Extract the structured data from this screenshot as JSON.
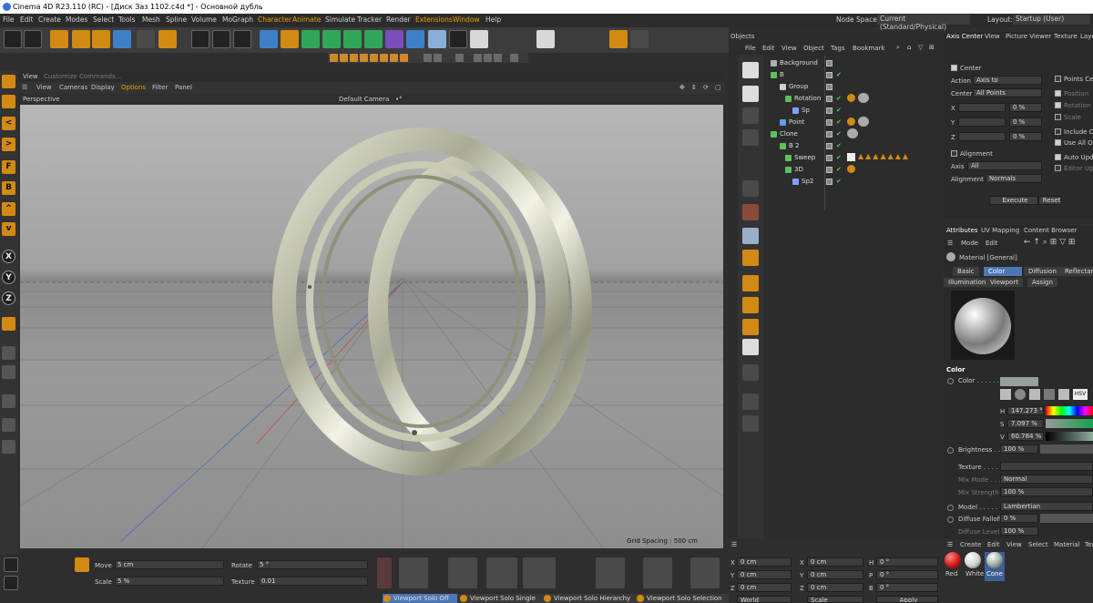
{
  "title": "Cinema 4D R23.110 (RC) - [Диск Заз 1102.c4d *] - Основной дубль",
  "menu": [
    "File",
    "Edit",
    "Create",
    "Modes",
    "Select",
    "Tools",
    "Mesh",
    "Spline",
    "Volume",
    "MoGraph",
    "Character",
    "Animate",
    "Simulate",
    "Tracker",
    "Render",
    "Extensions",
    "Window",
    "Help"
  ],
  "nodespace": {
    "label": "Node Space:",
    "value": "Current (Standard/Physical)"
  },
  "layout": {
    "label": "Layout:",
    "value": "Startup (User)"
  },
  "left_tools": [
    "F",
    "B",
    "X",
    "Y",
    "Z"
  ],
  "viewport": {
    "tab_view": "View",
    "tab_custom": "Customize Commands...",
    "menu": [
      "View",
      "Cameras",
      "Display",
      "Options",
      "Filter",
      "Panel"
    ],
    "name": "Perspective",
    "camera": "Default Camera",
    "camera_suffix": "•°",
    "grid_spacing": "Grid Spacing : 500 cm"
  },
  "coords": {
    "move_label": "Move",
    "move_value": "5 cm",
    "scale_label": "Scale",
    "scale_value": "5 %",
    "rotate_label": "Rotate",
    "rotate_value": "5 °",
    "texture_label": "Texture",
    "texture_value": "0.01"
  },
  "solo": [
    "Viewport Solo Off",
    "Viewport Solo Single",
    "Viewport Solo Hierarchy",
    "Viewport Solo Selection"
  ],
  "objects": {
    "tab": "Objects",
    "menu": [
      "File",
      "Edit",
      "View",
      "Object",
      "Tags",
      "Bookmark"
    ],
    "items": [
      {
        "name": "Background"
      },
      {
        "name": "B"
      },
      {
        "name": "Group"
      },
      {
        "name": "Rotation"
      },
      {
        "name": "Sp"
      },
      {
        "name": "Point"
      },
      {
        "name": "Clone"
      },
      {
        "name": "B 2"
      },
      {
        "name": "Sweep"
      },
      {
        "name": "3D"
      },
      {
        "name": "Sp2"
      }
    ]
  },
  "axis_panel": {
    "tabs": [
      "Axis Center",
      "View",
      "Picture Viewer",
      "Texture",
      "Layer"
    ],
    "center": "Center",
    "action_label": "Action",
    "action_value": "Axis to",
    "center_label": "Center",
    "center_value": "All Points",
    "x": "X",
    "y": "Y",
    "z": "Z",
    "pct": "0 %",
    "points_center": "Points Center",
    "position": "Position",
    "rotation": "Rotation",
    "scale": "Scale",
    "include_children": "Include Children",
    "use_all_objects": "Use All Objects",
    "alignment": "Alignment",
    "axis_label": "Axis",
    "axis_value": "All",
    "alignment_label": "Alignment",
    "alignment_value": "Normals",
    "auto_update": "Auto Update",
    "editor_update": "Editor Update",
    "execute": "Execute",
    "reset": "Reset"
  },
  "attributes": {
    "tabs": [
      "Attributes",
      "UV Mapping",
      "Content Browser"
    ],
    "mode": "Mode",
    "edit": "Edit",
    "material": "Material [General]",
    "mtabs": [
      "Basic",
      "Color",
      "Diffusion",
      "Reflectance"
    ],
    "mtabs2": [
      "Illumination",
      "Viewport",
      "Assign"
    ],
    "section": "Color",
    "color_label": "Color . . . . . .",
    "h_label": "H",
    "h_value": "147.273 °",
    "s_label": "S",
    "s_value": "7.097 %",
    "v_label": "V",
    "v_value": "60.784 %",
    "brightness_label": "Brightness . .",
    "brightness_value": "100 %",
    "texture_label": "Texture . . . . .",
    "mixmode_label": "Mix Mode . . .",
    "mixmode_value": "Normal",
    "mixstrength_label": "Mix Strength",
    "mixstrength_value": "100 %",
    "model_label": "Model . . . . . .",
    "model_value": "Lambertian",
    "falloff_label": "Diffuse Falloff",
    "falloff_value": "0 %",
    "level_label": "Diffuse Level",
    "level_value": "100 %",
    "hsv_button": "HSV"
  },
  "coord_manager": {
    "rows": [
      {
        "a": "X",
        "av": "0 cm",
        "b": "X",
        "bv": "0 cm",
        "c": "H",
        "cv": "0 °"
      },
      {
        "a": "Y",
        "av": "0 cm",
        "b": "Y",
        "bv": "0 cm",
        "c": "P",
        "cv": "0 °"
      },
      {
        "a": "Z",
        "av": "0 cm",
        "b": "Z",
        "bv": "0 cm",
        "c": "B",
        "cv": "0 °"
      }
    ],
    "world": "World",
    "scale": "Scale",
    "apply": "Apply"
  },
  "materials": {
    "menu": [
      "Create",
      "Edit",
      "View",
      "Select",
      "Material",
      "Texture"
    ],
    "items": [
      {
        "name": "Red",
        "color": "#d01818"
      },
      {
        "name": "White",
        "color": "#dddddd"
      },
      {
        "name": "Cone",
        "color": "#9aa8a0"
      }
    ]
  },
  "colors": {
    "accent": "#d28a12",
    "selection": "#4d76b5",
    "check": "#4cd04c"
  }
}
